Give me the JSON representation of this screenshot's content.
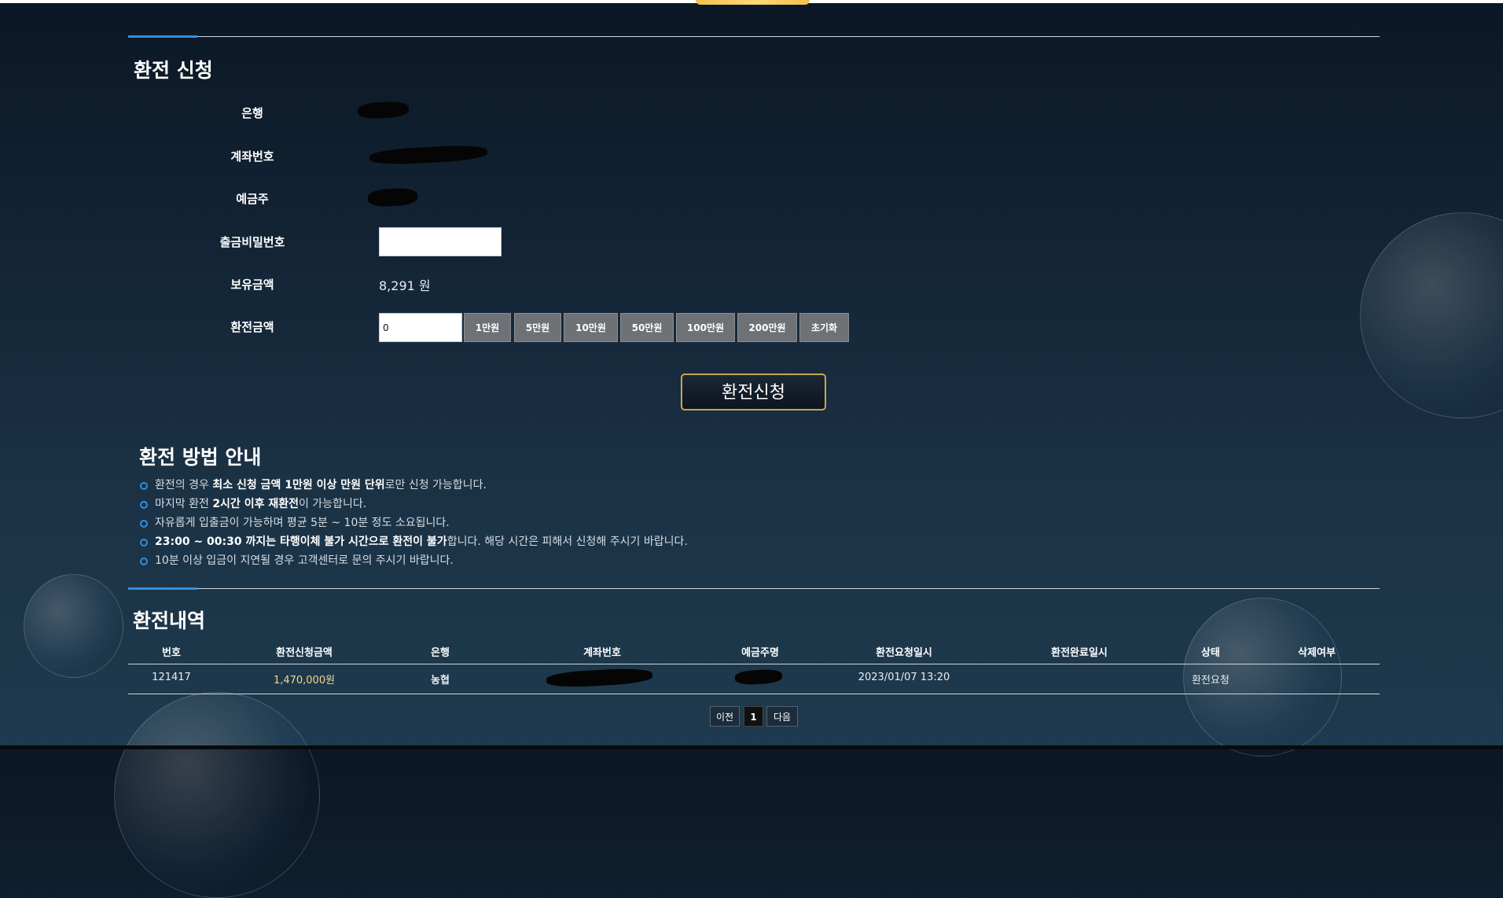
{
  "apply": {
    "title": "환전 신청",
    "labels": {
      "bank": "은행",
      "account": "계좌번호",
      "holder": "예금주",
      "password": "출금비밀번호",
      "balance": "보유금액",
      "amount": "환전금액"
    },
    "balance_value": "8,291 원",
    "amount_value": "0",
    "amount_buttons": [
      "1만원",
      "5만원",
      "10만원",
      "50만원",
      "100만원",
      "200만원",
      "초기화"
    ],
    "submit_label": "환전신청"
  },
  "guide": {
    "title": "환전 방법 안내",
    "items": [
      {
        "pre": "환전의 경우 ",
        "bold": "최소 신청 금액 1만원 이상 만원 단위",
        "post": "로만 신청 가능합니다."
      },
      {
        "pre": "마지막 환전 ",
        "bold": "2시간 이후 재환전",
        "post": "이 가능합니다."
      },
      {
        "pre": "자유롭게 입출금이 가능하며 평균 5분 ~ 10분 정도 소요됩니다.",
        "bold": "",
        "post": ""
      },
      {
        "pre": "",
        "bold": "23:00 ~ 00:30 까지는 타행이체 불가 시간으로 환전이 불가",
        "post": "합니다. 해당 시간은 피해서 신청해 주시기 바랍니다."
      },
      {
        "pre": "10분 이상 입금이 지연될 경우 고객센터로 문의 주시기 바랍니다.",
        "bold": "",
        "post": ""
      }
    ]
  },
  "history": {
    "title": "환전내역",
    "columns": [
      "번호",
      "환전신청금액",
      "은행",
      "계좌번호",
      "예금주명",
      "환전요청일시",
      "환전완료일시",
      "상태",
      "삭제여부"
    ],
    "rows": [
      {
        "no": "121417",
        "amount": "1,470,000원",
        "bank": "농협",
        "requested": "2023/01/07 13:20",
        "completed": "",
        "status": "환전요청",
        "deleted": ""
      }
    ]
  },
  "pagination": {
    "prev": "이전",
    "current": "1",
    "next": "다음"
  },
  "colors": {
    "accent_blue": "#2f8fe0",
    "gold_border": "#c9a64a",
    "amount_gold": "#f4d58a"
  }
}
